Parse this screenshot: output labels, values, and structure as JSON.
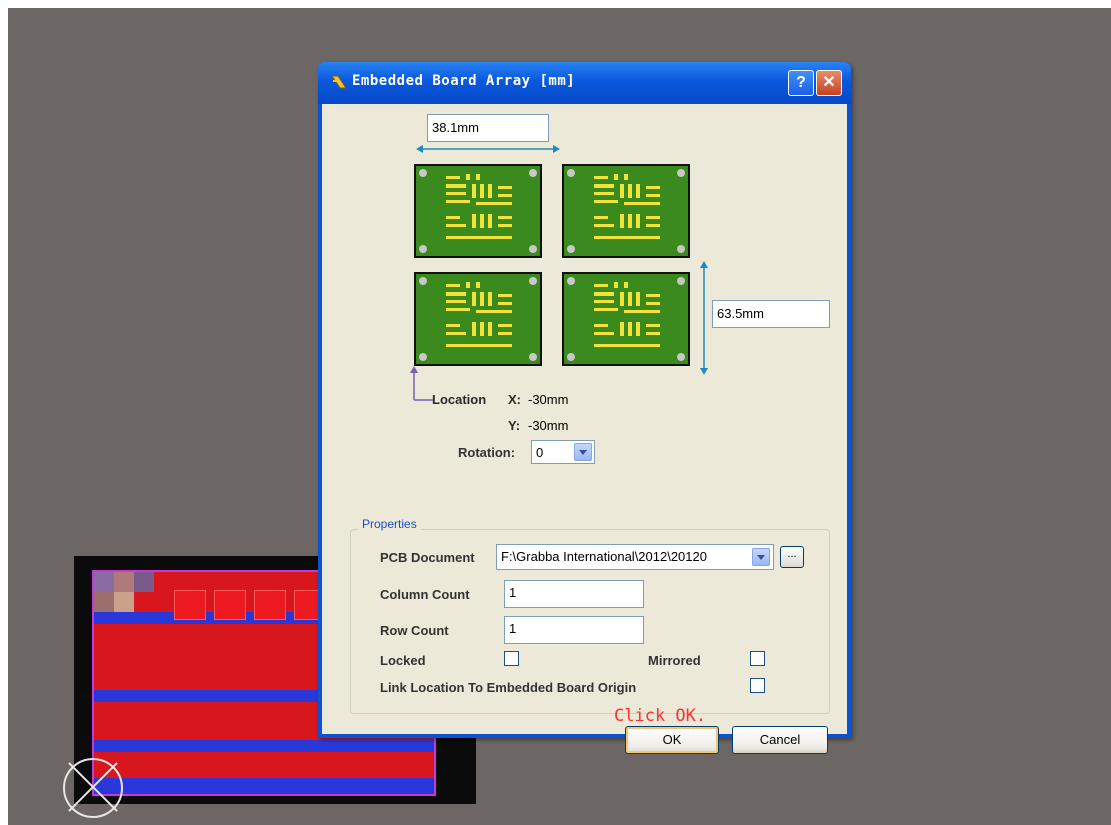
{
  "dialog": {
    "title": "Embedded Board Array [mm]",
    "help_label": "?",
    "close_label": "✕"
  },
  "diagram": {
    "width_value": "38.1mm",
    "height_value": "63.5mm",
    "location_label": "Location",
    "x_label": "X:",
    "x_value": "-30mm",
    "y_label": "Y:",
    "y_value": "-30mm",
    "rotation_label": "Rotation:",
    "rotation_value": "0"
  },
  "properties": {
    "legend": "Properties",
    "pcb_document_label": "PCB Document",
    "pcb_document_value": "F:\\Grabba International\\2012\\20120",
    "browse_label": "...",
    "column_count_label": "Column Count",
    "column_count_value": "1",
    "row_count_label": "Row Count",
    "row_count_value": "1",
    "locked_label": "Locked",
    "mirrored_label": "Mirrored",
    "link_label": "Link Location To Embedded Board Origin"
  },
  "annotation": "Click OK.",
  "buttons": {
    "ok_label": "OK",
    "cancel_label": "Cancel"
  },
  "colors": {
    "workspace": "#6c6765",
    "titlebar": "#0a58dc",
    "board_green": "#3a8a1e",
    "pad_yellow": "#f2e33a",
    "pcb_red": "#d7161d",
    "annotation_red": "#ff3030"
  }
}
